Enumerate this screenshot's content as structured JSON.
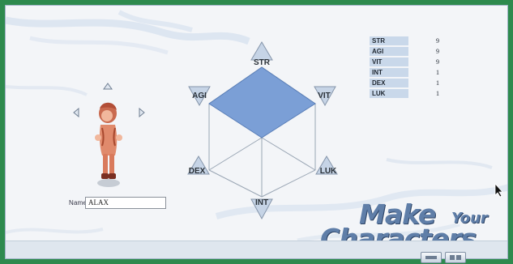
{
  "stats": [
    {
      "name": "STR",
      "value": "9"
    },
    {
      "name": "AGI",
      "value": "9"
    },
    {
      "name": "VIT",
      "value": "9"
    },
    {
      "name": "INT",
      "value": "1"
    },
    {
      "name": "DEX",
      "value": "1"
    },
    {
      "name": "LUK",
      "value": "1"
    }
  ],
  "hexagon_labels": {
    "str": "STR",
    "agi": "AGI",
    "vit": "VIT",
    "dex": "DEX",
    "luk": "LUK",
    "int": "INT"
  },
  "name_field": {
    "label": "Name",
    "value": "ALAX"
  },
  "title": {
    "line1": "Make",
    "line1_suffix": "Your",
    "line2": "Characters"
  },
  "colors": {
    "frame": "#2e8a4e",
    "stat_fill": "#7b9fd6",
    "stat_row_bg": "#c9d8ea",
    "title_text": "#5f7ea8"
  },
  "icons": {
    "rotate_up": "triangle-up",
    "rotate_left": "chevron-left",
    "rotate_right": "chevron-right"
  }
}
